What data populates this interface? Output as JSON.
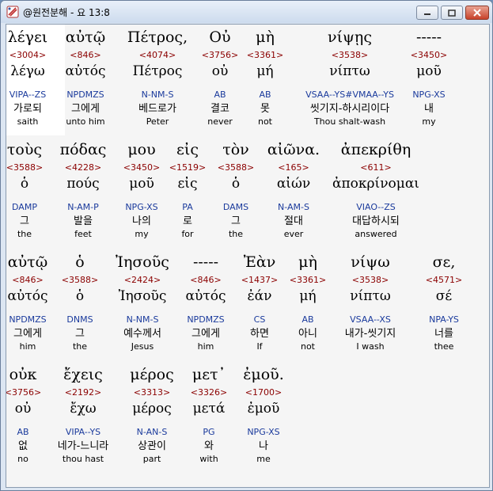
{
  "window": {
    "title": "@원전분해 - 요 13:8"
  },
  "icons": {
    "app": "app-icon",
    "minimize": "minimize-icon",
    "maximize": "maximize-icon",
    "close": "close-icon"
  },
  "colors": {
    "strongs": "#8b0000",
    "morph": "#1a3a9c",
    "selection": "#ffffff"
  },
  "rows": [
    {
      "tokens": [
        {
          "greek": "λέγει",
          "strongs": "<3004>",
          "lemma": "λέγω",
          "morph": "VIPA--ZS",
          "korean": "가로되",
          "english": "saith",
          "selected": true
        },
        {
          "greek": "αὐτῷ",
          "strongs": "<846>",
          "lemma": "αὐτός",
          "morph": "NPDMZS",
          "korean": "그에게",
          "english": "unto him"
        },
        {
          "greek": "Πέτρος,",
          "strongs": "<4074>",
          "lemma": "Πέτρος",
          "morph": "N-NM-S",
          "korean": "베드로가",
          "english": "Peter"
        },
        {
          "greek": "Οὐ",
          "strongs": "<3756>",
          "lemma": "οὐ",
          "morph": "AB",
          "korean": "결코",
          "english": "never"
        },
        {
          "greek": "μὴ",
          "strongs": "<3361>",
          "lemma": "μή",
          "morph": "AB",
          "korean": "못",
          "english": "not"
        },
        {
          "greek": "νίψῃς",
          "strongs": "<3538>",
          "lemma": "νίπτω",
          "morph": "VSAA--YS#VMAA--YS",
          "korean": "씻기지-하시리이다",
          "english": "Thou shalt-wash"
        },
        {
          "greek": "-----",
          "strongs": "<3450>",
          "lemma": "μοῦ",
          "morph": "NPG-XS",
          "korean": "내",
          "english": "my"
        }
      ]
    },
    {
      "tokens": [
        {
          "greek": "τοὺς",
          "strongs": "<3588>",
          "lemma": "ὁ",
          "morph": "DAMP",
          "korean": "그",
          "english": "the"
        },
        {
          "greek": "πόδας",
          "strongs": "<4228>",
          "lemma": "πούς",
          "morph": "N-AM-P",
          "korean": "발을",
          "english": "feet"
        },
        {
          "greek": "μου",
          "strongs": "<3450>",
          "lemma": "μοῦ",
          "morph": "NPG-XS",
          "korean": "나의",
          "english": "my"
        },
        {
          "greek": "εἰς",
          "strongs": "<1519>",
          "lemma": "εἰς",
          "morph": "PA",
          "korean": "로",
          "english": "for"
        },
        {
          "greek": "τὸν",
          "strongs": "<3588>",
          "lemma": "ὁ",
          "morph": "DAMS",
          "korean": "그",
          "english": "the"
        },
        {
          "greek": "αἰῶνα.",
          "strongs": "<165>",
          "lemma": "αἰών",
          "morph": "N-AM-S",
          "korean": "절대",
          "english": "ever"
        },
        {
          "greek": "ἀπεκρίθη",
          "strongs": "<611>",
          "lemma": "ἀποκρίνομαι",
          "morph": "VIAO--ZS",
          "korean": "대답하시되",
          "english": "answered"
        }
      ]
    },
    {
      "tokens": [
        {
          "greek": "αὐτῷ",
          "strongs": "<846>",
          "lemma": "αὐτός",
          "morph": "NPDMZS",
          "korean": "그에게",
          "english": "him"
        },
        {
          "greek": "ὁ",
          "strongs": "<3588>",
          "lemma": "ὁ",
          "morph": "DNMS",
          "korean": "그",
          "english": "the"
        },
        {
          "greek": "Ἰησοῦς",
          "strongs": "<2424>",
          "lemma": "Ἰησοῦς",
          "morph": "N-NM-S",
          "korean": "예수께서",
          "english": "Jesus"
        },
        {
          "greek": "-----",
          "strongs": "<846>",
          "lemma": "αὐτός",
          "morph": "NPDMZS",
          "korean": "그에게",
          "english": "him"
        },
        {
          "greek": "Ἐὰν",
          "strongs": "<1437>",
          "lemma": "ἐάν",
          "morph": "CS",
          "korean": "하면",
          "english": "If"
        },
        {
          "greek": "μὴ",
          "strongs": "<3361>",
          "lemma": "μή",
          "morph": "AB",
          "korean": "아니",
          "english": "not"
        },
        {
          "greek": "νίψω",
          "strongs": "<3538>",
          "lemma": "νίπτω",
          "morph": "VSAA--XS",
          "korean": "내가-씻기지",
          "english": "I wash"
        },
        {
          "greek": "σε,",
          "strongs": "<4571>",
          "lemma": "σέ",
          "morph": "NPA-YS",
          "korean": "너를",
          "english": "thee"
        }
      ]
    },
    {
      "tokens": [
        {
          "greek": "οὐκ",
          "strongs": "<3756>",
          "lemma": "οὐ",
          "morph": "AB",
          "korean": "없",
          "english": "no"
        },
        {
          "greek": "ἔχεις",
          "strongs": "<2192>",
          "lemma": "ἔχω",
          "morph": "VIPA--YS",
          "korean": "네가-느니라",
          "english": "thou hast"
        },
        {
          "greek": "μέρος",
          "strongs": "<3313>",
          "lemma": "μέρος",
          "morph": "N-AN-S",
          "korean": "상관이",
          "english": "part"
        },
        {
          "greek": "μετ᾽",
          "strongs": "<3326>",
          "lemma": "μετά",
          "morph": "PG",
          "korean": "와",
          "english": "with"
        },
        {
          "greek": "ἐμοῦ.",
          "strongs": "<1700>",
          "lemma": "ἐμοῦ",
          "morph": "NPG-XS",
          "korean": "나",
          "english": "me"
        }
      ]
    }
  ]
}
